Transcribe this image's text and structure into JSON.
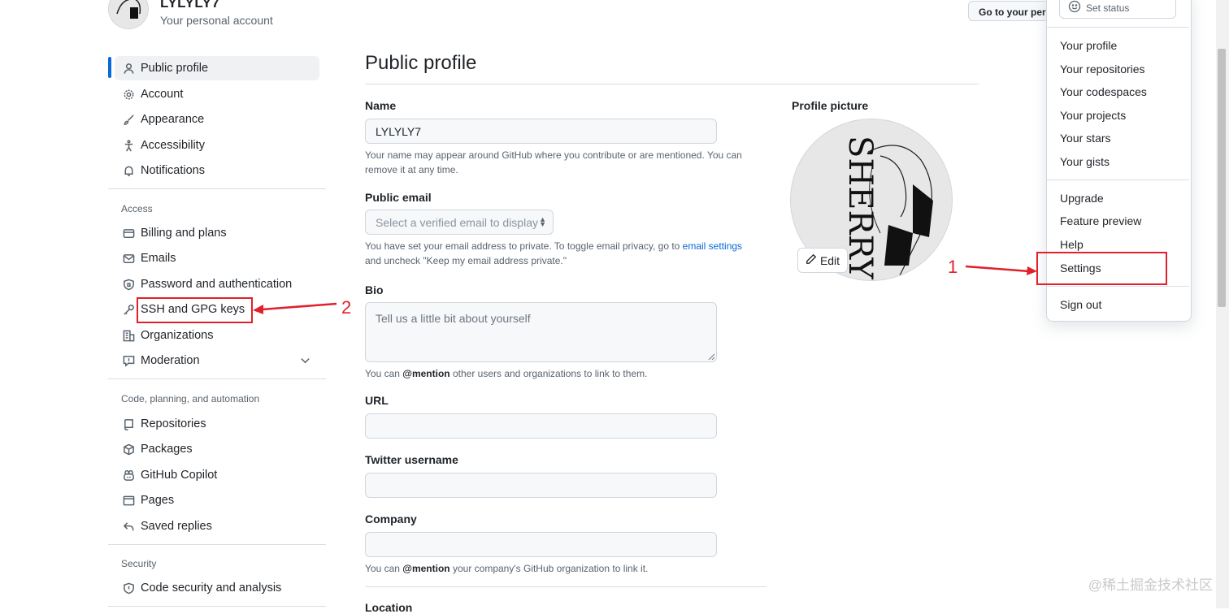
{
  "header": {
    "account_name": "LYLYLY7",
    "account_subtitle": "Your personal account",
    "goto_button": "Go to your personal profile"
  },
  "sidebar": {
    "items": [
      {
        "label": "Public profile",
        "icon": "person-icon",
        "active": true
      },
      {
        "label": "Account",
        "icon": "gear-icon"
      },
      {
        "label": "Appearance",
        "icon": "paintbrush-icon"
      },
      {
        "label": "Accessibility",
        "icon": "accessibility-icon"
      },
      {
        "label": "Notifications",
        "icon": "bell-icon"
      }
    ],
    "access_heading": "Access",
    "access_items": [
      {
        "label": "Billing and plans",
        "icon": "credit-card-icon"
      },
      {
        "label": "Emails",
        "icon": "mail-icon"
      },
      {
        "label": "Password and authentication",
        "icon": "shield-lock-icon"
      },
      {
        "label": "SSH and GPG keys",
        "icon": "key-icon"
      },
      {
        "label": "Organizations",
        "icon": "organization-icon"
      },
      {
        "label": "Moderation",
        "icon": "report-icon"
      }
    ],
    "code_heading": "Code, planning, and automation",
    "code_items": [
      {
        "label": "Repositories",
        "icon": "repo-icon"
      },
      {
        "label": "Packages",
        "icon": "package-icon"
      },
      {
        "label": "GitHub Copilot",
        "icon": "copilot-icon"
      },
      {
        "label": "Pages",
        "icon": "browser-icon"
      },
      {
        "label": "Saved replies",
        "icon": "reply-icon"
      }
    ],
    "security_heading": "Security",
    "security_items": [
      {
        "label": "Code security and analysis",
        "icon": "shield-icon"
      }
    ]
  },
  "main": {
    "title": "Public profile",
    "name_label": "Name",
    "name_value": "LYLYLY7",
    "name_note": "Your name may appear around GitHub where you contribute or are mentioned. You can remove it at any time.",
    "email_label": "Public email",
    "email_placeholder": "Select a verified email to display",
    "email_note_1": "You have set your email address to private. To toggle email privacy, go to ",
    "email_note_link": "email settings",
    "email_note_2": " and uncheck \"Keep my email address private.\"",
    "bio_label": "Bio",
    "bio_placeholder": "Tell us a little bit about yourself",
    "bio_note_1": "You can ",
    "bio_note_mention": "@mention",
    "bio_note_2": " other users and organizations to link to them.",
    "url_label": "URL",
    "twitter_label": "Twitter username",
    "company_label": "Company",
    "company_note_1": "You can ",
    "company_note_mention": "@mention",
    "company_note_2": " your company's GitHub organization to link it.",
    "location_label": "Location",
    "profile_picture_label": "Profile picture",
    "avatar_text": "SHERRY",
    "edit_button": "Edit"
  },
  "menu": {
    "set_status": "Set status",
    "group1": [
      "Your profile",
      "Your repositories",
      "Your codespaces",
      "Your projects",
      "Your stars",
      "Your gists"
    ],
    "group2": [
      "Upgrade",
      "Feature preview",
      "Help",
      "Settings"
    ],
    "sign_out": "Sign out"
  },
  "annotations": {
    "marker_1": "1",
    "marker_2": "2",
    "color": "#e0202a"
  },
  "watermark": "@稀土掘金技术社区",
  "colors": {
    "accent": "#0969da",
    "annotation": "#e0202a"
  }
}
